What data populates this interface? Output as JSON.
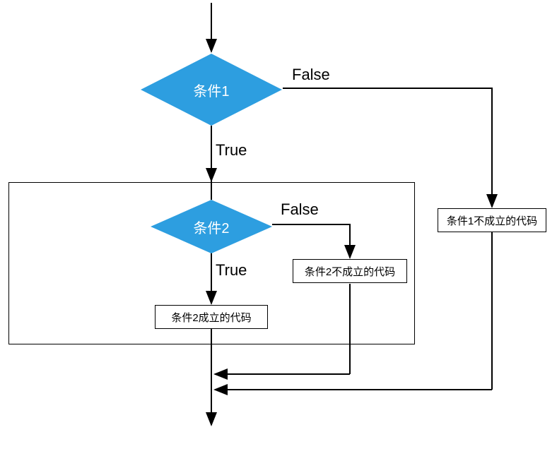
{
  "diagram": {
    "type": "flowchart",
    "decision1": {
      "label": "条件1",
      "true_label": "True",
      "false_label": "False"
    },
    "decision2": {
      "label": "条件2",
      "true_label": "True",
      "false_label": "False"
    },
    "box_true2": "条件2成立的代码",
    "box_false2": "条件2不成立的代码",
    "box_false1": "条件1不成立的代码"
  }
}
